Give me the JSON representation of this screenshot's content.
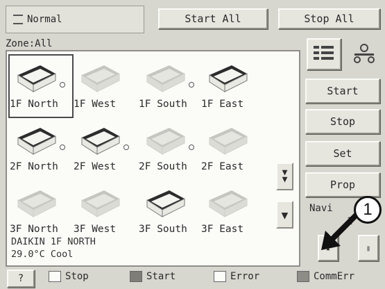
{
  "header": {
    "mode_label": "Normal",
    "start_all_label": "Start All",
    "stop_all_label": "Stop All"
  },
  "zone": {
    "label": "Zone:All"
  },
  "units": [
    {
      "name": "1F North",
      "state": "selected-running"
    },
    {
      "name": "1F West",
      "state": "faded"
    },
    {
      "name": "1F South",
      "state": "faded"
    },
    {
      "name": "1F East",
      "state": "running"
    },
    {
      "name": "2F North",
      "state": "running"
    },
    {
      "name": "2F West",
      "state": "running"
    },
    {
      "name": "2F South",
      "state": "faded"
    },
    {
      "name": "2F East",
      "state": "faded"
    },
    {
      "name": "3F North",
      "state": "faded"
    },
    {
      "name": "3F West",
      "state": "faded"
    },
    {
      "name": "3F South",
      "state": "running"
    },
    {
      "name": "3F East",
      "state": "faded"
    }
  ],
  "status": {
    "unit_name": "DAIKIN 1F NORTH",
    "reading": "29.0°C  Cool"
  },
  "side_buttons": {
    "start": "Start",
    "stop": "Stop",
    "set": "Set",
    "prop": "Prop"
  },
  "nav": {
    "label": "Navi",
    "page": "1"
  },
  "legend": {
    "stop": "Stop",
    "start": "Start",
    "error": "Error",
    "comm_err": "CommErr"
  },
  "callout": {
    "number": "1"
  },
  "colors": {
    "background": "#d7d6cf",
    "panel": "#fbfbf8",
    "start_swatch": "#7f7d78",
    "commerr_swatch": "#8e8c87",
    "arrow": "#111111"
  },
  "icons": [
    "list-view-icon",
    "group-view-icon",
    "scroll-page-down-icon",
    "scroll-down-icon",
    "scroll-up-icon",
    "help-icon"
  ]
}
